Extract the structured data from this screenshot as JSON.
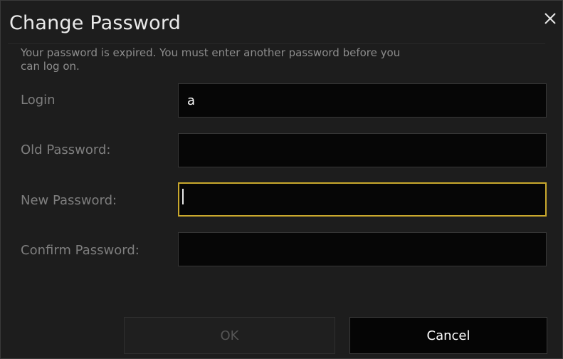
{
  "dialog": {
    "title": "Change Password",
    "message": "Your password is expired. You must enter another password before you can log on."
  },
  "form": {
    "login_label": "Login",
    "login_value": "a",
    "old_password_label": "Old Password:",
    "old_password_value": "",
    "new_password_label": "New Password:",
    "new_password_value": "",
    "confirm_password_label": "Confirm Password:",
    "confirm_password_value": ""
  },
  "buttons": {
    "ok_label": "OK",
    "cancel_label": "Cancel"
  },
  "colors": {
    "background": "#1d1d1d",
    "field_background": "#060606",
    "focus_border": "#c9a82d",
    "label_text": "#7e7e7e"
  },
  "icons": {
    "close": "close-icon"
  }
}
